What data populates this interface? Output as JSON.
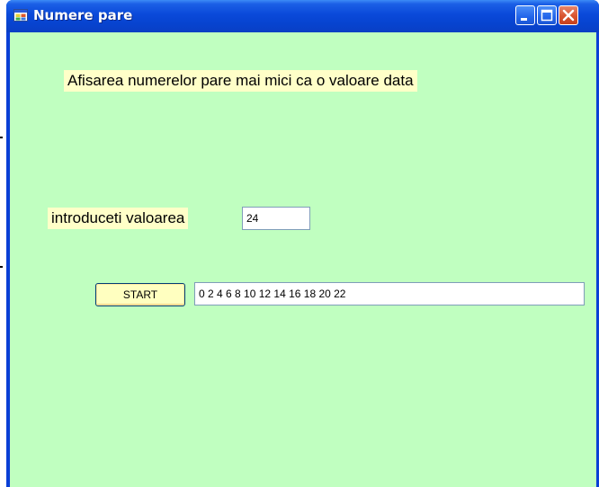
{
  "window": {
    "title": "Numere pare",
    "controls": {
      "minimize": "minimize-icon",
      "maximize": "maximize-icon",
      "close": "close-icon"
    }
  },
  "form": {
    "heading": "Afisarea numerelor pare mai mici ca o valoare data",
    "value_label": "introduceti valoarea",
    "value_input": "24",
    "start_label": "START",
    "result": "0 2 4 6 8 10 12 14 16 18 20 22"
  },
  "colors": {
    "client_background": "#c0ffc0",
    "label_background": "#ffffc8",
    "button_background": "#ffffc0",
    "titlebar": "#0a49d9",
    "close_button": "#d8542f"
  }
}
